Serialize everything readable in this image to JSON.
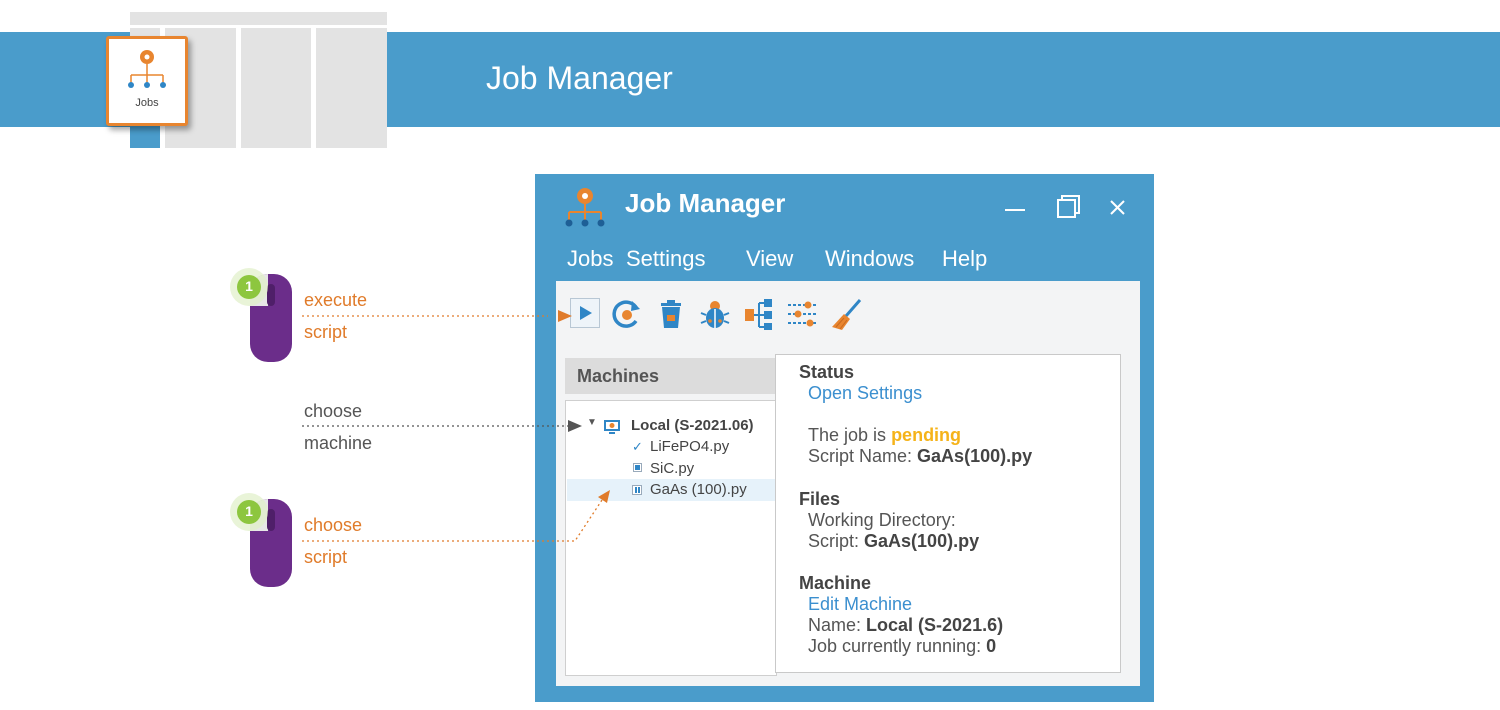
{
  "banner": {
    "title": "Job Manager",
    "tile_label": "Jobs"
  },
  "window": {
    "title": "Job Manager",
    "controls": [
      "minimize-icon",
      "maximize-icon",
      "close-icon"
    ],
    "menu": [
      "Jobs",
      "Settings",
      "View",
      "Windows",
      "Help"
    ]
  },
  "toolbar": {
    "buttons": [
      "play-icon",
      "refresh-icon",
      "trash-icon",
      "bug-icon",
      "tree-icon",
      "sliders-icon",
      "broom-icon"
    ]
  },
  "machines": {
    "header": "Machines",
    "root": "Local (S-2021.06)",
    "items": [
      {
        "name": "LiFePO4.py",
        "status": "done"
      },
      {
        "name": "SiC.py",
        "status": "stopped"
      },
      {
        "name": "GaAs (100).py",
        "status": "paused"
      }
    ]
  },
  "details": {
    "status_heading": "Status",
    "open_settings": "Open Settings",
    "job_prefix": "The job is",
    "job_state": "pending",
    "script_name_label": "Script Name:",
    "script_name_value": "GaAs(100).py",
    "files_heading": "Files",
    "working_dir_label": "Working Directory:",
    "script_label": "Script:",
    "script_value": "GaAs(100).py",
    "machine_heading": "Machine",
    "edit_machine": "Edit Machine",
    "name_label": "Name:",
    "name_value": "Local (S-2021.6)",
    "running_label": "Job currently running:",
    "running_value": "0"
  },
  "annotations": {
    "step1": {
      "badge": "1",
      "line1": "execute",
      "line2": "script"
    },
    "step2": {
      "line1": "choose",
      "line2": "machine"
    },
    "step3": {
      "badge": "1",
      "line1": "choose",
      "line2": "script"
    }
  },
  "colors": {
    "accent": "#4a9ccb",
    "orange": "#e07b2a",
    "pending": "#f5b31a",
    "link": "#3b8fcf",
    "mouse": "#6b2d8a",
    "badge": "#8dc63f"
  }
}
